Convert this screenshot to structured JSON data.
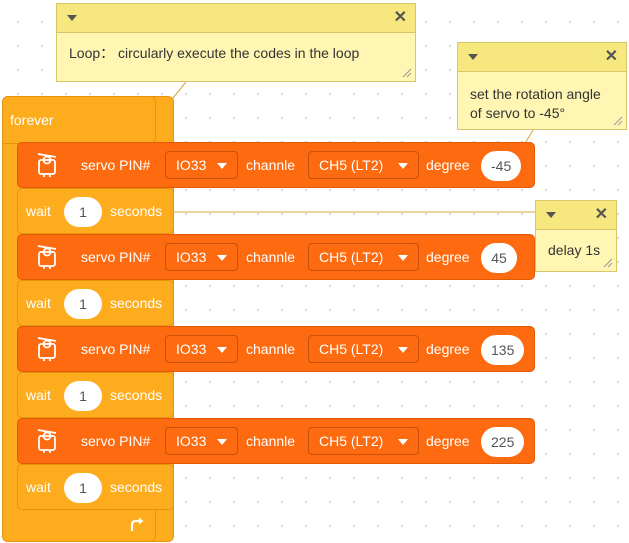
{
  "forever": {
    "label": "forever"
  },
  "servo_blocks": [
    {
      "pin_label": "servo PIN#",
      "pin_value": "IO33",
      "channel_label": "channle",
      "channel_value": "CH5 (LT2)",
      "degree_label": "degree",
      "degree_value": "-45"
    },
    {
      "pin_label": "servo PIN#",
      "pin_value": "IO33",
      "channel_label": "channle",
      "channel_value": "CH5 (LT2)",
      "degree_label": "degree",
      "degree_value": "45"
    },
    {
      "pin_label": "servo PIN#",
      "pin_value": "IO33",
      "channel_label": "channle",
      "channel_value": "CH5 (LT2)",
      "degree_label": "degree",
      "degree_value": "135"
    },
    {
      "pin_label": "servo PIN#",
      "pin_value": "IO33",
      "channel_label": "channle",
      "channel_value": "CH5 (LT2)",
      "degree_label": "degree",
      "degree_value": "225"
    }
  ],
  "wait_blocks": [
    {
      "wait_label": "wait",
      "value": "1",
      "unit": "seconds"
    },
    {
      "wait_label": "wait",
      "value": "1",
      "unit": "seconds"
    },
    {
      "wait_label": "wait",
      "value": "1",
      "unit": "seconds"
    },
    {
      "wait_label": "wait",
      "value": "1",
      "unit": "seconds"
    }
  ],
  "comments": {
    "loop": {
      "text": "Loop： circularly execute the codes in the loop"
    },
    "rotation": {
      "line1": "set the rotation angle",
      "line2": "of servo to -45°"
    },
    "delay": {
      "text": "delay 1s"
    }
  },
  "colors": {
    "control_orange": "#fdac1e",
    "servo_orange": "#fd6a0f",
    "comment_yellow": "#fff6b3"
  },
  "icons": {
    "servo": "servo-motor-icon",
    "loop": "loop-arrow-icon",
    "collapse": "chevron-down-icon",
    "close": "close-icon"
  }
}
